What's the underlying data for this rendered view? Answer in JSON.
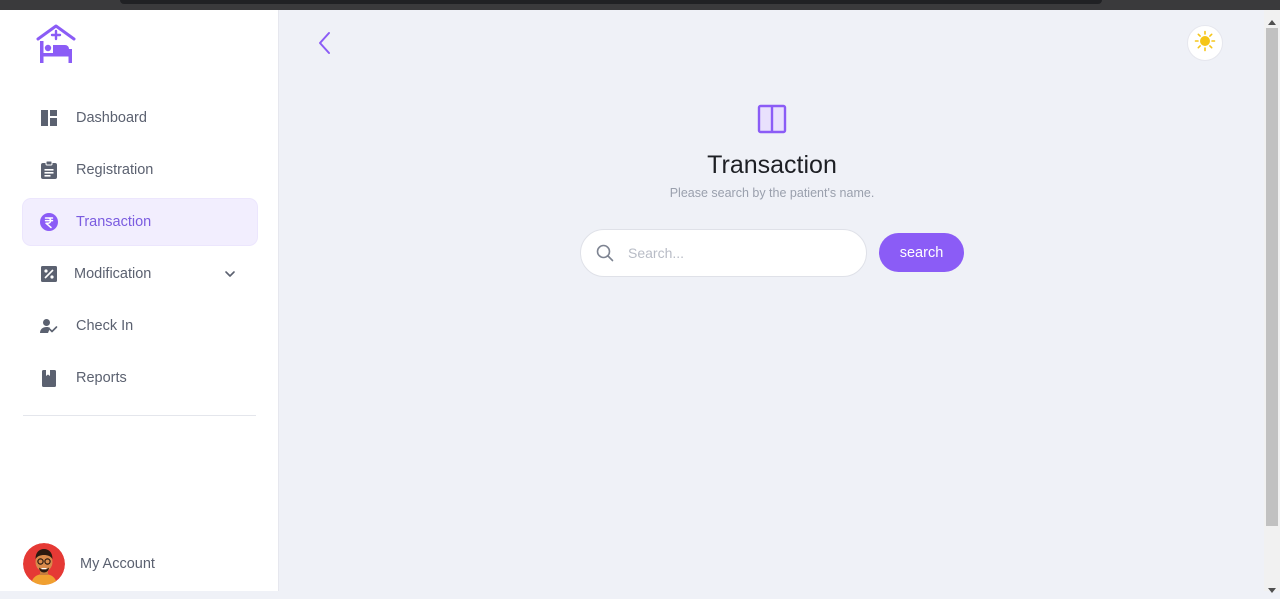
{
  "sidebar": {
    "logo_icon": "hospital-bed-icon",
    "items": [
      {
        "label": "Dashboard",
        "icon": "dashboard-icon"
      },
      {
        "label": "Registration",
        "icon": "clipboard-icon"
      },
      {
        "label": "Transaction",
        "icon": "rupee-icon",
        "active": true
      },
      {
        "label": "Modification",
        "icon": "percent-box-icon",
        "has_dropdown": true
      },
      {
        "label": "Check In",
        "icon": "user-check-icon"
      },
      {
        "label": "Reports",
        "icon": "book-icon"
      }
    ],
    "account_label": "My Account"
  },
  "main": {
    "title": "Transaction",
    "subtitle": "Please search by the patient's name.",
    "search_placeholder": "Search...",
    "search_value": "",
    "search_button": "search"
  },
  "colors": {
    "accent": "#8b5cf6",
    "active_bg": "#f2eefe",
    "page_bg": "#eff1f7",
    "sun": "#f5c518"
  }
}
